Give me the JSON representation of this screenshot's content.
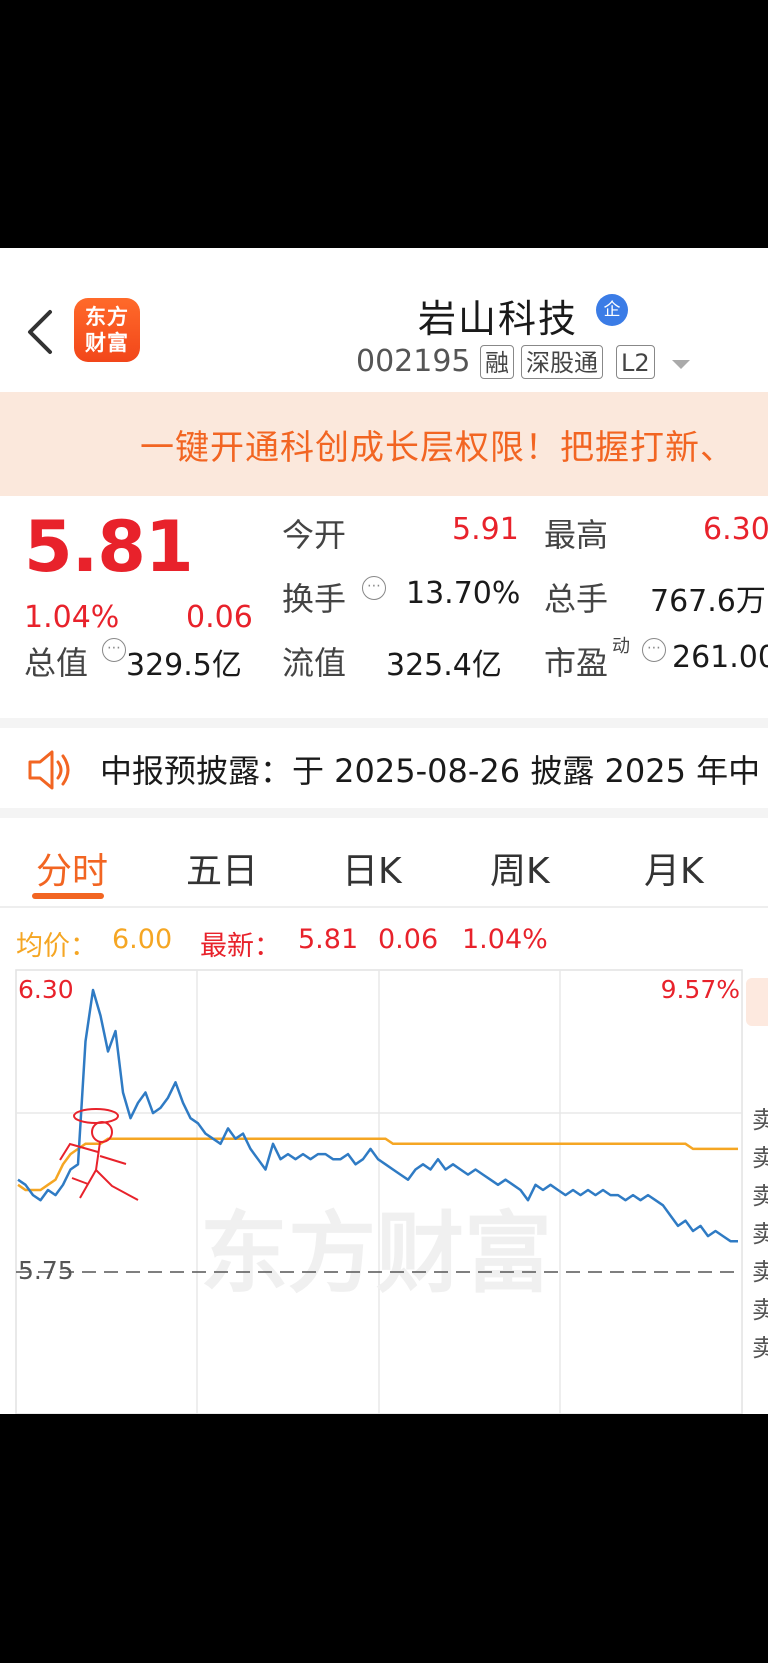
{
  "header": {
    "logo_line1": "东方",
    "logo_line2": "财富",
    "stock_name": "岩山科技",
    "qi_badge": "企",
    "stock_code": "002195",
    "tags": [
      "融",
      "深股通",
      "L2"
    ]
  },
  "banner": {
    "text": "一键开通科创成长层权限！把握打新、"
  },
  "quote": {
    "price": "5.81",
    "change_pct": "1.04%",
    "change": "0.06",
    "open_label": "今开",
    "open_value": "5.91",
    "high_label": "最高",
    "high_value": "6.30",
    "turnover_label": "换手",
    "turnover_value": "13.70%",
    "volume_label": "总手",
    "volume_value": "767.6万",
    "mktcap_label": "总值",
    "mktcap_value": "329.5亿",
    "float_label": "流值",
    "float_value": "325.4亿",
    "pe_label": "市盈",
    "pe_sup": "动",
    "pe_value": "261.00"
  },
  "notice": {
    "text": "中报预披露：于 2025-08-26 披露 2025 年中"
  },
  "tabs": [
    "分时",
    "五日",
    "日K",
    "周K",
    "月K"
  ],
  "active_tab": 0,
  "chart_header": {
    "avg_label": "均价：",
    "avg_value": "6.00",
    "latest_label": "最新：",
    "latest_price": "5.81",
    "latest_change": "0.06",
    "latest_pct": "1.04%"
  },
  "side_chars": [
    "卖",
    "卖",
    "卖",
    "卖",
    "卖",
    "卖",
    "卖"
  ],
  "colors": {
    "up_red": "#e8222b",
    "accent_orange": "#f26522",
    "avg_line": "#f5a623",
    "price_line": "#2f7bc4"
  },
  "chart_data": {
    "type": "line",
    "y_top_label": "6.30",
    "y_top_pct": "9.57%",
    "y_bottom_label": "5.75",
    "ylim": [
      5.75,
      6.3
    ],
    "reference_price": 6.0,
    "watermark": "东方财富",
    "series": [
      {
        "values": [
          5.93,
          5.92,
          5.9,
          5.89,
          5.91,
          5.9,
          5.92,
          5.95,
          5.96,
          6.2,
          6.3,
          6.25,
          6.18,
          6.22,
          6.1,
          6.05,
          6.08,
          6.1,
          6.06,
          6.07,
          6.09,
          6.12,
          6.08,
          6.05,
          6.04,
          6.02,
          6.01,
          6.0,
          6.03,
          6.01,
          6.02,
          5.99,
          5.97,
          5.95,
          6.0,
          5.97,
          5.98,
          5.97,
          5.98,
          5.97,
          5.98,
          5.98,
          5.97,
          5.97,
          5.98,
          5.96,
          5.97,
          5.99,
          5.97,
          5.96,
          5.95,
          5.94,
          5.93,
          5.95,
          5.96,
          5.95,
          5.97,
          5.95,
          5.96,
          5.95,
          5.94,
          5.95,
          5.94,
          5.93,
          5.92,
          5.93,
          5.92,
          5.91,
          5.89,
          5.92,
          5.91,
          5.92,
          5.91,
          5.9,
          5.91,
          5.9,
          5.91,
          5.9,
          5.91,
          5.9,
          5.9,
          5.89,
          5.9,
          5.89,
          5.9,
          5.89,
          5.88,
          5.86,
          5.84,
          5.85,
          5.83,
          5.84,
          5.82,
          5.83,
          5.82,
          5.81,
          5.81
        ]
      },
      {
        "values": [
          5.92,
          5.91,
          5.91,
          5.91,
          5.92,
          5.93,
          5.96,
          5.98,
          5.99,
          6.0,
          6.0,
          6.0,
          6.01,
          6.01,
          6.01,
          6.01,
          6.01,
          6.01,
          6.01,
          6.01,
          6.01,
          6.01,
          6.01,
          6.01,
          6.01,
          6.01,
          6.01,
          6.01,
          6.01,
          6.01,
          6.01,
          6.01,
          6.01,
          6.01,
          6.01,
          6.01,
          6.01,
          6.01,
          6.01,
          6.01,
          6.01,
          6.01,
          6.01,
          6.01,
          6.01,
          6.01,
          6.01,
          6.01,
          6.01,
          6.01,
          6.0,
          6.0,
          6.0,
          6.0,
          6.0,
          6.0,
          6.0,
          6.0,
          6.0,
          6.0,
          6.0,
          6.0,
          6.0,
          6.0,
          6.0,
          6.0,
          6.0,
          6.0,
          6.0,
          6.0,
          6.0,
          6.0,
          6.0,
          6.0,
          6.0,
          6.0,
          6.0,
          6.0,
          6.0,
          6.0,
          6.0,
          6.0,
          6.0,
          6.0,
          6.0,
          6.0,
          6.0,
          6.0,
          6.0,
          6.0,
          5.99,
          5.99,
          5.99,
          5.99,
          5.99,
          5.99,
          5.99
        ]
      }
    ]
  }
}
